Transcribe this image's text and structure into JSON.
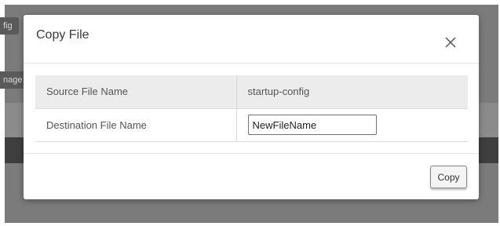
{
  "background": {
    "button_1_label": "fig",
    "button_2_label": "nage"
  },
  "dialog": {
    "title": "Copy File",
    "close_icon": "close-icon",
    "rows": [
      {
        "label": "Source File Name",
        "value": "startup-config"
      },
      {
        "label": "Destination File Name",
        "input_value": "NewFileName"
      }
    ],
    "copy_button_label": "Copy"
  },
  "colors": {
    "overlay": "#7b7b7b",
    "row_shade": "#ececec",
    "dialog_bg": "#ffffff"
  }
}
